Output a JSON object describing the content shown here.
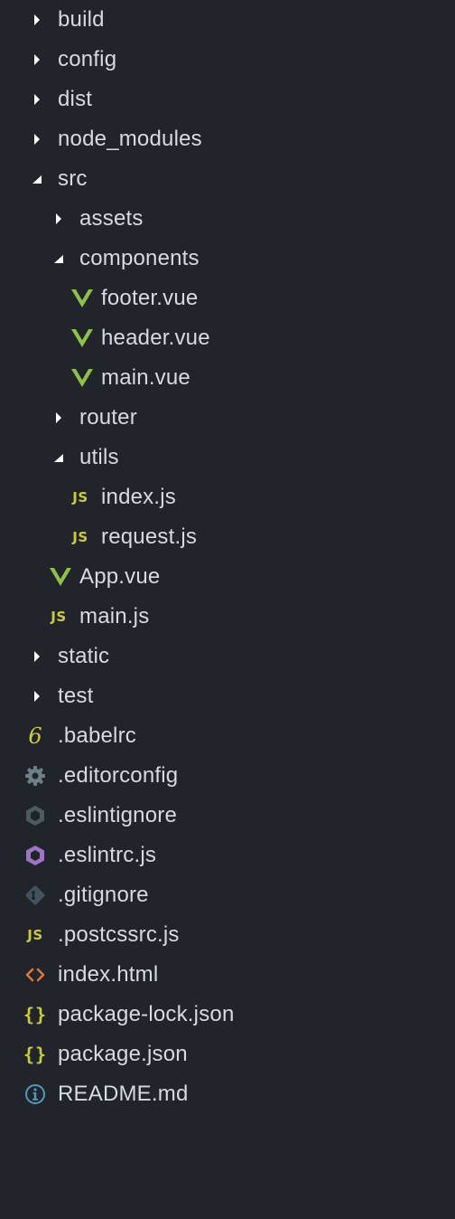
{
  "explorer": {
    "colors": {
      "background": "#21252b",
      "text": "#d7dae0",
      "arrow": "#ffffff",
      "vue": "#8dc149",
      "js": "#cbcb41",
      "config": "#6d8086",
      "eslint": "#a074c4",
      "html": "#e37933",
      "info": "#519aba"
    },
    "items": [
      {
        "label": "build",
        "kind": "folder",
        "state": "collapsed",
        "icon": "chevron-right-icon"
      },
      {
        "label": "config",
        "kind": "folder",
        "state": "collapsed",
        "icon": "chevron-right-icon"
      },
      {
        "label": "dist",
        "kind": "folder",
        "state": "collapsed",
        "icon": "chevron-right-icon"
      },
      {
        "label": "node_modules",
        "kind": "folder",
        "state": "collapsed",
        "icon": "chevron-right-icon"
      },
      {
        "label": "src",
        "kind": "folder",
        "state": "expanded",
        "icon": "chevron-down-icon"
      },
      {
        "label": "assets",
        "kind": "folder",
        "state": "collapsed",
        "icon": "chevron-right-icon"
      },
      {
        "label": "components",
        "kind": "folder",
        "state": "expanded",
        "icon": "chevron-down-icon"
      },
      {
        "label": "footer.vue",
        "kind": "file",
        "icon": "vue-icon"
      },
      {
        "label": "header.vue",
        "kind": "file",
        "icon": "vue-icon"
      },
      {
        "label": "main.vue",
        "kind": "file",
        "icon": "vue-icon"
      },
      {
        "label": "router",
        "kind": "folder",
        "state": "collapsed",
        "icon": "chevron-right-icon"
      },
      {
        "label": "utils",
        "kind": "folder",
        "state": "expanded",
        "icon": "chevron-down-icon"
      },
      {
        "label": "index.js",
        "kind": "file",
        "icon": "js-icon",
        "icon_text": "JS"
      },
      {
        "label": "request.js",
        "kind": "file",
        "icon": "js-icon",
        "icon_text": "JS"
      },
      {
        "label": "App.vue",
        "kind": "file",
        "icon": "vue-icon"
      },
      {
        "label": "main.js",
        "kind": "file",
        "icon": "js-icon",
        "icon_text": "JS"
      },
      {
        "label": "static",
        "kind": "folder",
        "state": "collapsed",
        "icon": "chevron-right-icon"
      },
      {
        "label": "test",
        "kind": "folder",
        "state": "collapsed",
        "icon": "chevron-right-icon"
      },
      {
        "label": ".babelrc",
        "kind": "file",
        "icon": "babel-icon",
        "icon_text": "6"
      },
      {
        "label": ".editorconfig",
        "kind": "file",
        "icon": "gear-icon"
      },
      {
        "label": ".eslintignore",
        "kind": "file",
        "icon": "eslint-ignore-icon"
      },
      {
        "label": ".eslintrc.js",
        "kind": "file",
        "icon": "eslint-icon"
      },
      {
        "label": ".gitignore",
        "kind": "file",
        "icon": "git-icon"
      },
      {
        "label": ".postcssrc.js",
        "kind": "file",
        "icon": "js-icon",
        "icon_text": "JS"
      },
      {
        "label": "index.html",
        "kind": "file",
        "icon": "html-icon"
      },
      {
        "label": "package-lock.json",
        "kind": "file",
        "icon": "json-icon",
        "icon_text": "{}"
      },
      {
        "label": "package.json",
        "kind": "file",
        "icon": "json-icon",
        "icon_text": "{}"
      },
      {
        "label": "README.md",
        "kind": "file",
        "icon": "info-icon"
      }
    ]
  }
}
